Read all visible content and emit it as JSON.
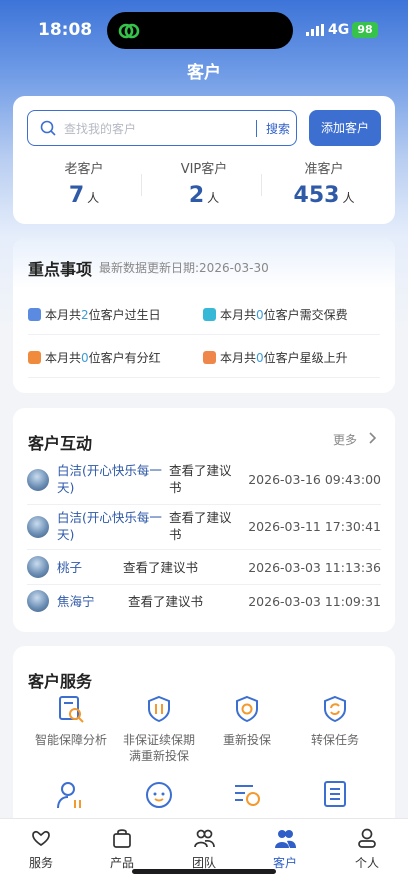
{
  "status": {
    "time": "18:08",
    "network": "4G",
    "battery": "98"
  },
  "header": {
    "title": "客户"
  },
  "search": {
    "placeholder": "查找我的客户",
    "button": "搜索",
    "add_button": "添加客户"
  },
  "stats": [
    {
      "label": "老客户",
      "value": "7",
      "unit": "人"
    },
    {
      "label": "VIP客户",
      "value": "2",
      "unit": "人"
    },
    {
      "label": "准客户",
      "value": "453",
      "unit": "人"
    }
  ],
  "key_items": {
    "title": "重点事项",
    "update_date": "最新数据更新日期:2026-03-30",
    "items": [
      {
        "pre": "本月共",
        "count": "2",
        "post": "位客户过生日",
        "icon": "calendar-icon",
        "color": "#5b8be0"
      },
      {
        "pre": "本月共",
        "count": "0",
        "post": "位客户需交保费",
        "icon": "payment-icon",
        "color": "#36b8d6"
      },
      {
        "pre": "本月共",
        "count": "0",
        "post": "位客户有分红",
        "icon": "dividend-icon",
        "color": "#f08a3c"
      },
      {
        "pre": "本月共",
        "count": "0",
        "post": "位客户星级上升",
        "icon": "star-rise-icon",
        "color": "#f0874a"
      }
    ]
  },
  "interactions": {
    "title": "客户互动",
    "more": "更多",
    "rows": [
      {
        "name_l1": "白洁(开心快乐每一",
        "name_l2": "天)",
        "action_l1": "查看了建议",
        "action_l2": "书",
        "time": "2026-03-16 09:43:00"
      },
      {
        "name_l1": "白洁(开心快乐每一",
        "name_l2": "天)",
        "action_l1": "查看了建议",
        "action_l2": "书",
        "time": "2026-03-11 17:30:41"
      },
      {
        "name_l1": "桃子",
        "name_l2": "",
        "action_l1": "查看了建议书",
        "action_l2": "",
        "time": "2026-03-03 11:13:36"
      },
      {
        "name_l1": "焦海宁",
        "name_l2": "",
        "action_l1": "查看了建议书",
        "action_l2": "",
        "time": "2026-03-03 11:09:31"
      }
    ]
  },
  "services": {
    "title": "客户服务",
    "items": [
      {
        "label_l1": "智能保障分析",
        "label_l2": ""
      },
      {
        "label_l1": "非保证续保期",
        "label_l2": "满重新投保"
      },
      {
        "label_l1": "重新投保",
        "label_l2": ""
      },
      {
        "label_l1": "转保任务",
        "label_l2": ""
      }
    ]
  },
  "tabs": [
    {
      "label": "服务"
    },
    {
      "label": "产品"
    },
    {
      "label": "团队"
    },
    {
      "label": "客户"
    },
    {
      "label": "个人"
    }
  ],
  "colors": {
    "accent": "#3d6fd1",
    "highlight": "#3d9cd6",
    "battery": "#36c24b"
  }
}
